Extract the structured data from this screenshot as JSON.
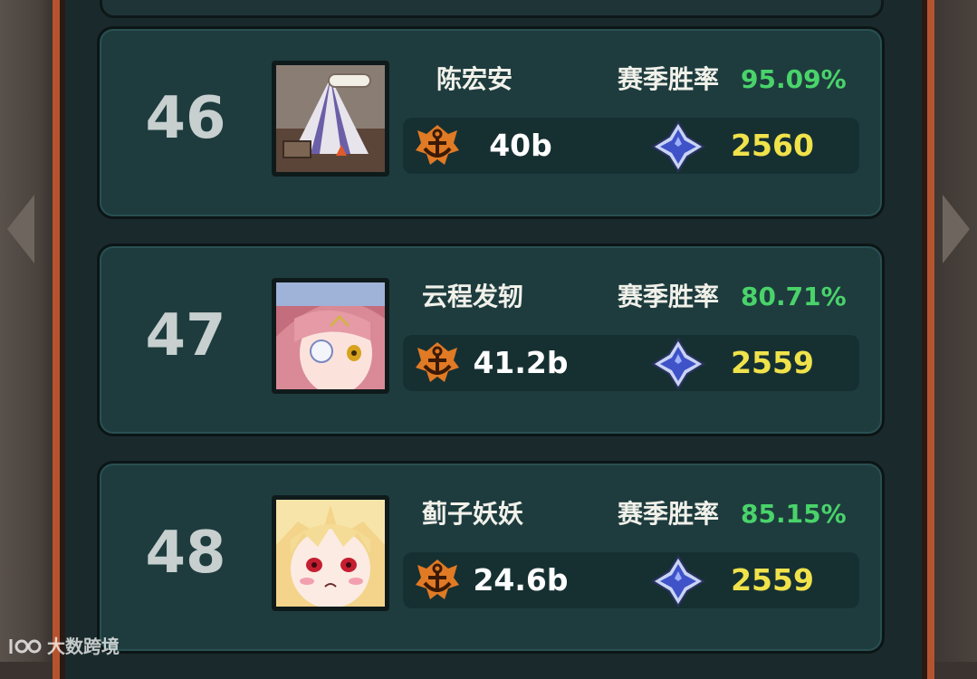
{
  "win_rate_label": "赛季胜率",
  "entries": [
    {
      "rank": "46",
      "name": "陈宏安",
      "win_rate": "95.09%",
      "power": "40b",
      "score": "2560",
      "avatar": "tent-scroll-avatar"
    },
    {
      "rank": "47",
      "name": "云程发轫",
      "win_rate": "80.71%",
      "power": "41.2b",
      "score": "2559",
      "avatar": "pink-hair-girl-avatar"
    },
    {
      "rank": "48",
      "name": "蓟子妖妖",
      "win_rate": "85.15%",
      "power": "24.6b",
      "score": "2559",
      "avatar": "blonde-girl-avatar"
    }
  ],
  "icons": {
    "power": "anchor-emblem-icon",
    "score": "blue-star-gem-icon"
  },
  "colors": {
    "card_bg": "#1e3c3e",
    "win_rate": "#49d36a",
    "score": "#f0e24a",
    "frame_border": "#b5532f"
  },
  "watermark": {
    "text": "大数跨境"
  }
}
